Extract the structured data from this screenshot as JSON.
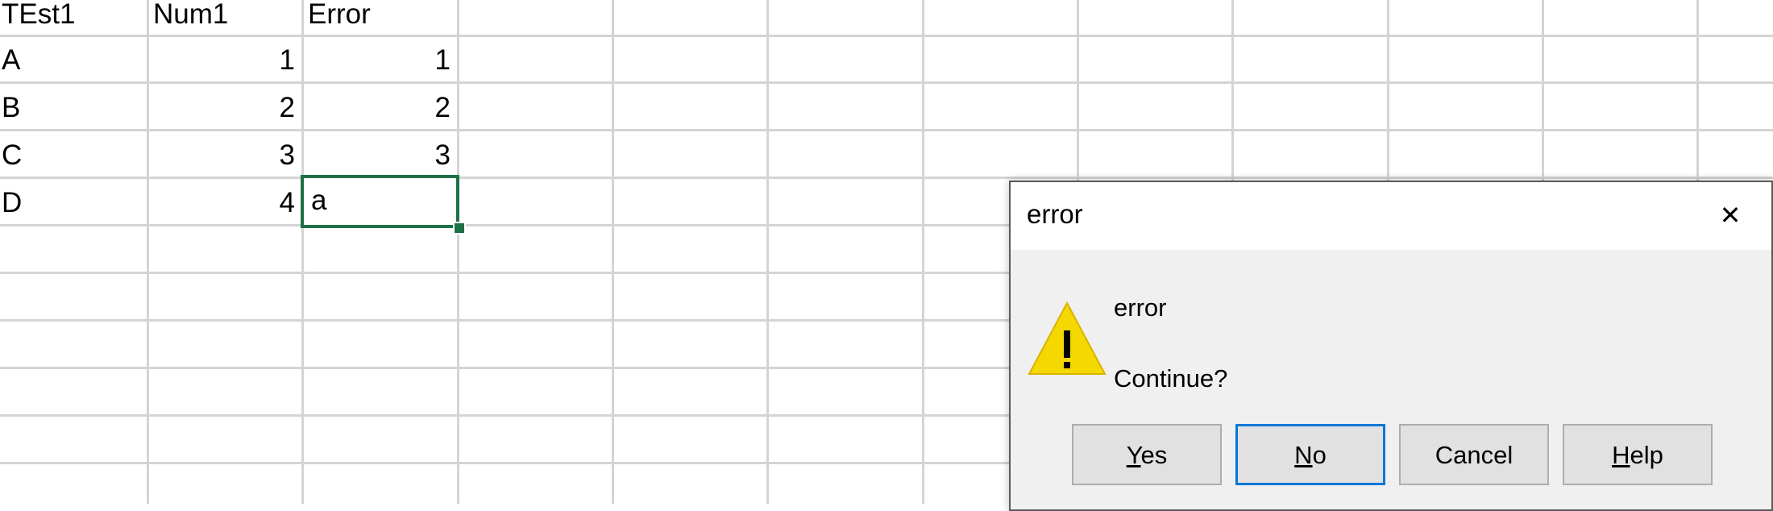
{
  "sheet": {
    "rows": [
      {
        "a": "TEst1",
        "b": "Num1",
        "c": "Error"
      },
      {
        "a": "A",
        "b": "1",
        "c": "1"
      },
      {
        "a": "B",
        "b": "2",
        "c": "2"
      },
      {
        "a": "C",
        "b": "3",
        "c": "3"
      },
      {
        "a": "D",
        "b": "4",
        "c": "a"
      }
    ],
    "active_cell_value": "a",
    "accent_color": "#1e7145"
  },
  "dialog": {
    "title": "error",
    "message": "error",
    "question": "Continue?",
    "icon": "warning-icon",
    "buttons": {
      "yes": {
        "mnemonic": "Y",
        "rest": "es"
      },
      "no": {
        "mnemonic": "N",
        "rest": "o"
      },
      "cancel": {
        "label": "Cancel"
      },
      "help": {
        "mnemonic": "H",
        "rest": "elp"
      }
    },
    "close_glyph": "✕"
  }
}
